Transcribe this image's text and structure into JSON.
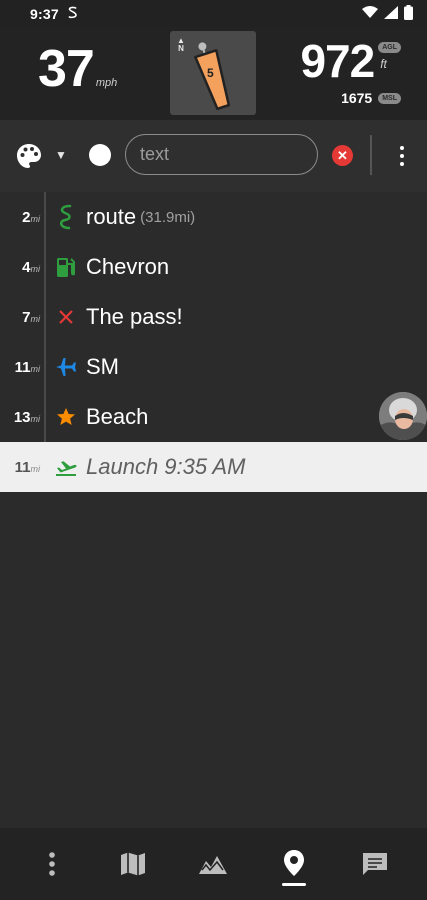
{
  "status_bar": {
    "time": "9:37",
    "notification_icon": "s-icon"
  },
  "instruments": {
    "speed": "37",
    "speed_unit": "mph",
    "compass_letter": "N",
    "compass_number": "5",
    "altitude_agl": "972",
    "altitude_unit": "ft",
    "agl_badge": "AGL",
    "altitude_msl": "1675",
    "msl_badge": "MSL"
  },
  "toolbar": {
    "search_placeholder": "text",
    "palette_icon": "palette-icon",
    "color": "#ffffff"
  },
  "waypoints": [
    {
      "dist": "2",
      "unit": "mi",
      "name": "route",
      "extra": "(31.9mi)",
      "icon": "route-icon",
      "color": "#2e9e3f"
    },
    {
      "dist": "4",
      "unit": "mi",
      "name": "Chevron",
      "extra": "",
      "icon": "gas-station-icon",
      "color": "#2e9e3f"
    },
    {
      "dist": "7",
      "unit": "mi",
      "name": "The pass!",
      "extra": "",
      "icon": "close-icon",
      "color": "#e53935"
    },
    {
      "dist": "11",
      "unit": "mi",
      "name": "SM",
      "extra": "",
      "icon": "airplane-icon",
      "color": "#1e88e5"
    },
    {
      "dist": "13",
      "unit": "mi",
      "name": "Beach",
      "extra": "",
      "icon": "star-icon",
      "color": "#fb8c00"
    },
    {
      "dist": "11",
      "unit": "mi",
      "name": "Launch 9:35 AM",
      "extra": "",
      "icon": "takeoff-icon",
      "color": "#2e9e3f"
    }
  ],
  "bottom_nav": [
    {
      "icon": "more-vert-icon"
    },
    {
      "icon": "map-icon"
    },
    {
      "icon": "terrain-icon"
    },
    {
      "icon": "waypoint-pin-icon",
      "selected": true
    },
    {
      "icon": "chat-icon"
    }
  ]
}
